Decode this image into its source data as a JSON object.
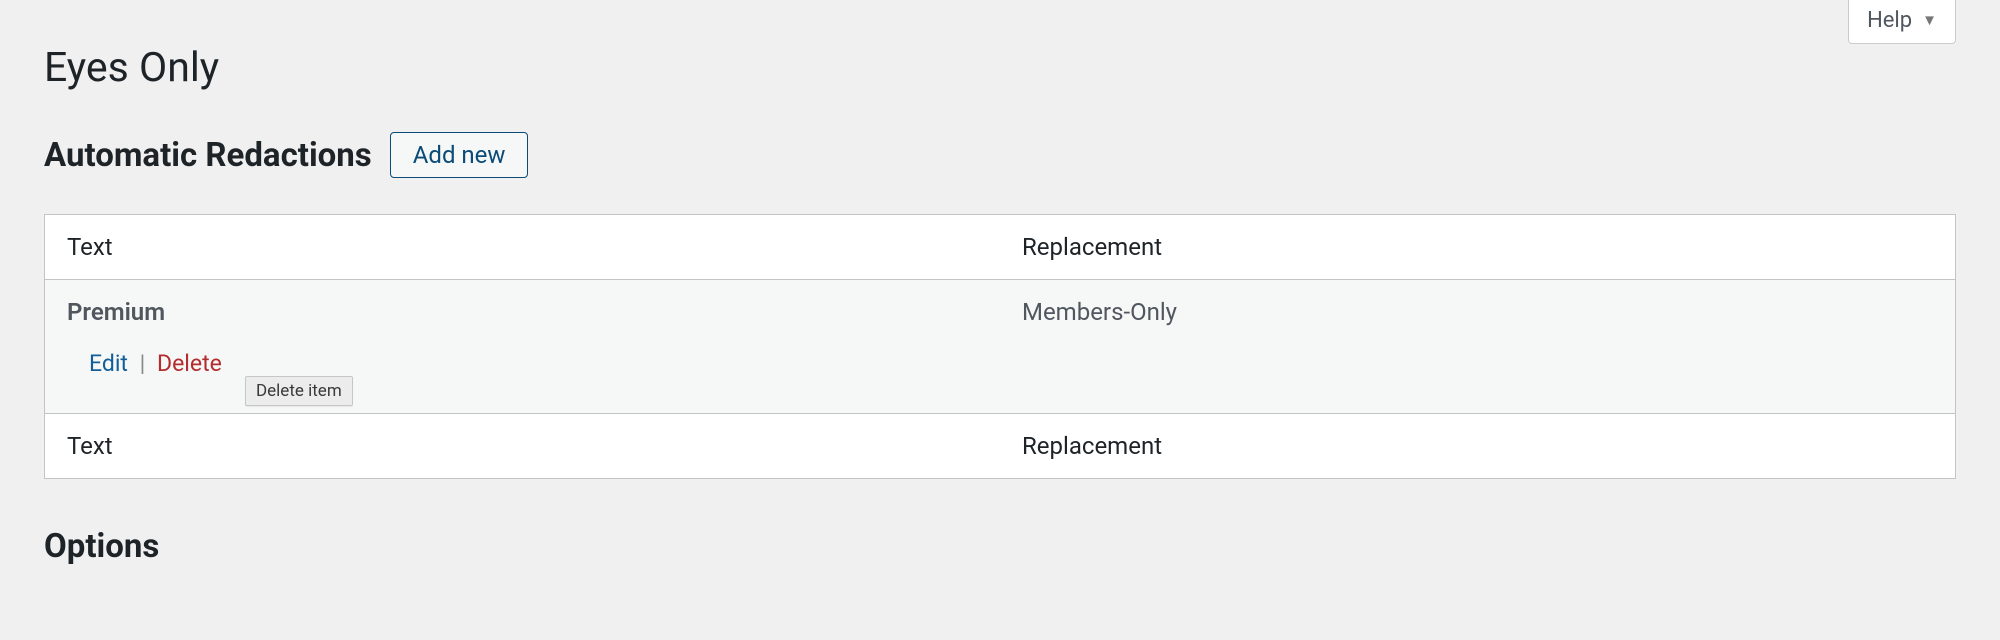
{
  "help": {
    "label": "Help"
  },
  "page_title": "Eyes Only",
  "sections": {
    "redactions": {
      "heading": "Automatic Redactions",
      "add_new_label": "Add new"
    },
    "options_heading": "Options"
  },
  "table": {
    "columns": {
      "text": "Text",
      "replacement": "Replacement"
    },
    "rows": [
      {
        "text": "Premium",
        "replacement": "Members-Only"
      }
    ],
    "row_actions": {
      "edit": "Edit",
      "separator": "|",
      "delete": "Delete"
    }
  },
  "tooltip": {
    "delete": "Delete item"
  }
}
